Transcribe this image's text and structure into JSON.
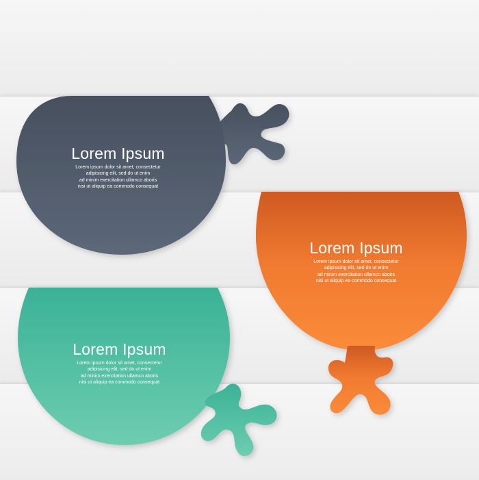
{
  "colors": {
    "background": "#f2f2f2",
    "slate": "#4f5a6b",
    "orange": "#f57d2e",
    "teal": "#48bb9f"
  },
  "bubbles": [
    {
      "title": "Lorem Ipsum",
      "lines": [
        "Lorem ipsum dolor sit amet, consectetur",
        "adipisicing elit, sed do ut enim",
        "ad minim exercitation ullamco aboris",
        "nisi ut aliquip ea commodo consequat"
      ]
    },
    {
      "title": "Lorem Ipsum",
      "lines": [
        "Lorem ipsum dolor sit amet, consectetur",
        "adipisicing elit, sed do ut enim",
        "ad minim exercitation ullamco aboris",
        "nisi ut aliquip ea commodo consequat"
      ]
    },
    {
      "title": "Lorem Ipsum",
      "lines": [
        "Lorem ipsum dolor sit amet, consectetur",
        "adipisicing elit, sed do ut enim",
        "ad minim exercitation ullamco aboris",
        "nisi ut aliquip ea commodo consequat"
      ]
    }
  ]
}
